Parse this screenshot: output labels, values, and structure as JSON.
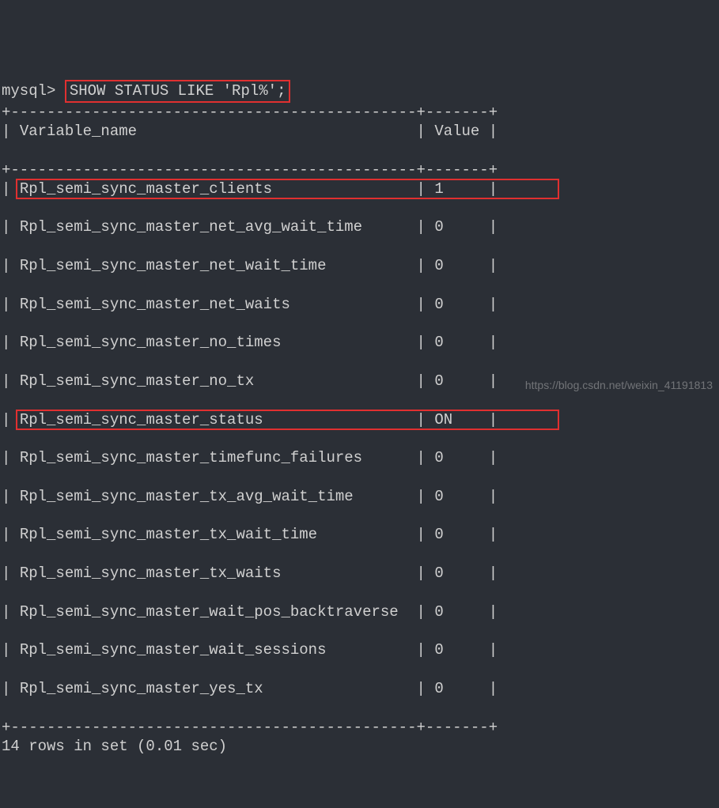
{
  "prompt": "mysql>",
  "command": "SHOW STATUS LIKE 'Rpl%';",
  "header": {
    "variable": "Variable_name",
    "value": "Value"
  },
  "divider_top": "+---------------------------------------------+-------+",
  "rows": [
    {
      "name": "Rpl_semi_sync_master_clients",
      "value": "1",
      "highlight": true
    },
    {
      "name": "Rpl_semi_sync_master_net_avg_wait_time",
      "value": "0",
      "highlight": false
    },
    {
      "name": "Rpl_semi_sync_master_net_wait_time",
      "value": "0",
      "highlight": false
    },
    {
      "name": "Rpl_semi_sync_master_net_waits",
      "value": "0",
      "highlight": false
    },
    {
      "name": "Rpl_semi_sync_master_no_times",
      "value": "0",
      "highlight": false
    },
    {
      "name": "Rpl_semi_sync_master_no_tx",
      "value": "0",
      "highlight": false
    },
    {
      "name": "Rpl_semi_sync_master_status",
      "value": "ON",
      "highlight": true
    },
    {
      "name": "Rpl_semi_sync_master_timefunc_failures",
      "value": "0",
      "highlight": false
    },
    {
      "name": "Rpl_semi_sync_master_tx_avg_wait_time",
      "value": "0",
      "highlight": false
    },
    {
      "name": "Rpl_semi_sync_master_tx_wait_time",
      "value": "0",
      "highlight": false
    },
    {
      "name": "Rpl_semi_sync_master_tx_waits",
      "value": "0",
      "highlight": false
    },
    {
      "name": "Rpl_semi_sync_master_wait_pos_backtraverse",
      "value": "0",
      "highlight": false
    },
    {
      "name": "Rpl_semi_sync_master_wait_sessions",
      "value": "0",
      "highlight": false
    },
    {
      "name": "Rpl_semi_sync_master_yes_tx",
      "value": "0",
      "highlight": false
    }
  ],
  "footer": "14 rows in set (0.01 sec)",
  "watermark": "https://blog.csdn.net/weixin_41191813",
  "chart_data": {
    "type": "table",
    "title": "SHOW STATUS LIKE 'Rpl%'",
    "columns": [
      "Variable_name",
      "Value"
    ],
    "data": [
      [
        "Rpl_semi_sync_master_clients",
        "1"
      ],
      [
        "Rpl_semi_sync_master_net_avg_wait_time",
        "0"
      ],
      [
        "Rpl_semi_sync_master_net_wait_time",
        "0"
      ],
      [
        "Rpl_semi_sync_master_net_waits",
        "0"
      ],
      [
        "Rpl_semi_sync_master_no_times",
        "0"
      ],
      [
        "Rpl_semi_sync_master_no_tx",
        "0"
      ],
      [
        "Rpl_semi_sync_master_status",
        "ON"
      ],
      [
        "Rpl_semi_sync_master_timefunc_failures",
        "0"
      ],
      [
        "Rpl_semi_sync_master_tx_avg_wait_time",
        "0"
      ],
      [
        "Rpl_semi_sync_master_tx_wait_time",
        "0"
      ],
      [
        "Rpl_semi_sync_master_tx_waits",
        "0"
      ],
      [
        "Rpl_semi_sync_master_wait_pos_backtraverse",
        "0"
      ],
      [
        "Rpl_semi_sync_master_wait_sessions",
        "0"
      ],
      [
        "Rpl_semi_sync_master_yes_tx",
        "0"
      ]
    ]
  }
}
